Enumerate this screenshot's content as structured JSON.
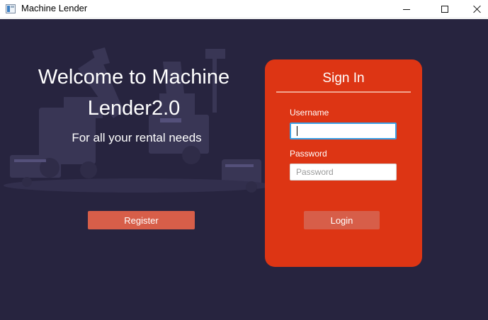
{
  "window": {
    "title": "Machine Lender",
    "icons": {
      "app": "app-window-icon",
      "minimize": "minimize-icon",
      "maximize": "maximize-icon",
      "close": "close-icon"
    }
  },
  "welcome": {
    "line1": "Welcome to Machine",
    "line2": "Lender2.0",
    "tagline": "For all your rental needs"
  },
  "register_button": {
    "label": "Register"
  },
  "signin": {
    "title": "Sign In",
    "username_label": "Username",
    "username_value": "",
    "password_label": "Password",
    "password_placeholder": "Password",
    "login_label": "Login"
  },
  "colors": {
    "background": "#27243f",
    "card": "#dd3514",
    "button": "#d75e49",
    "focus_border": "#3aa0e6"
  }
}
